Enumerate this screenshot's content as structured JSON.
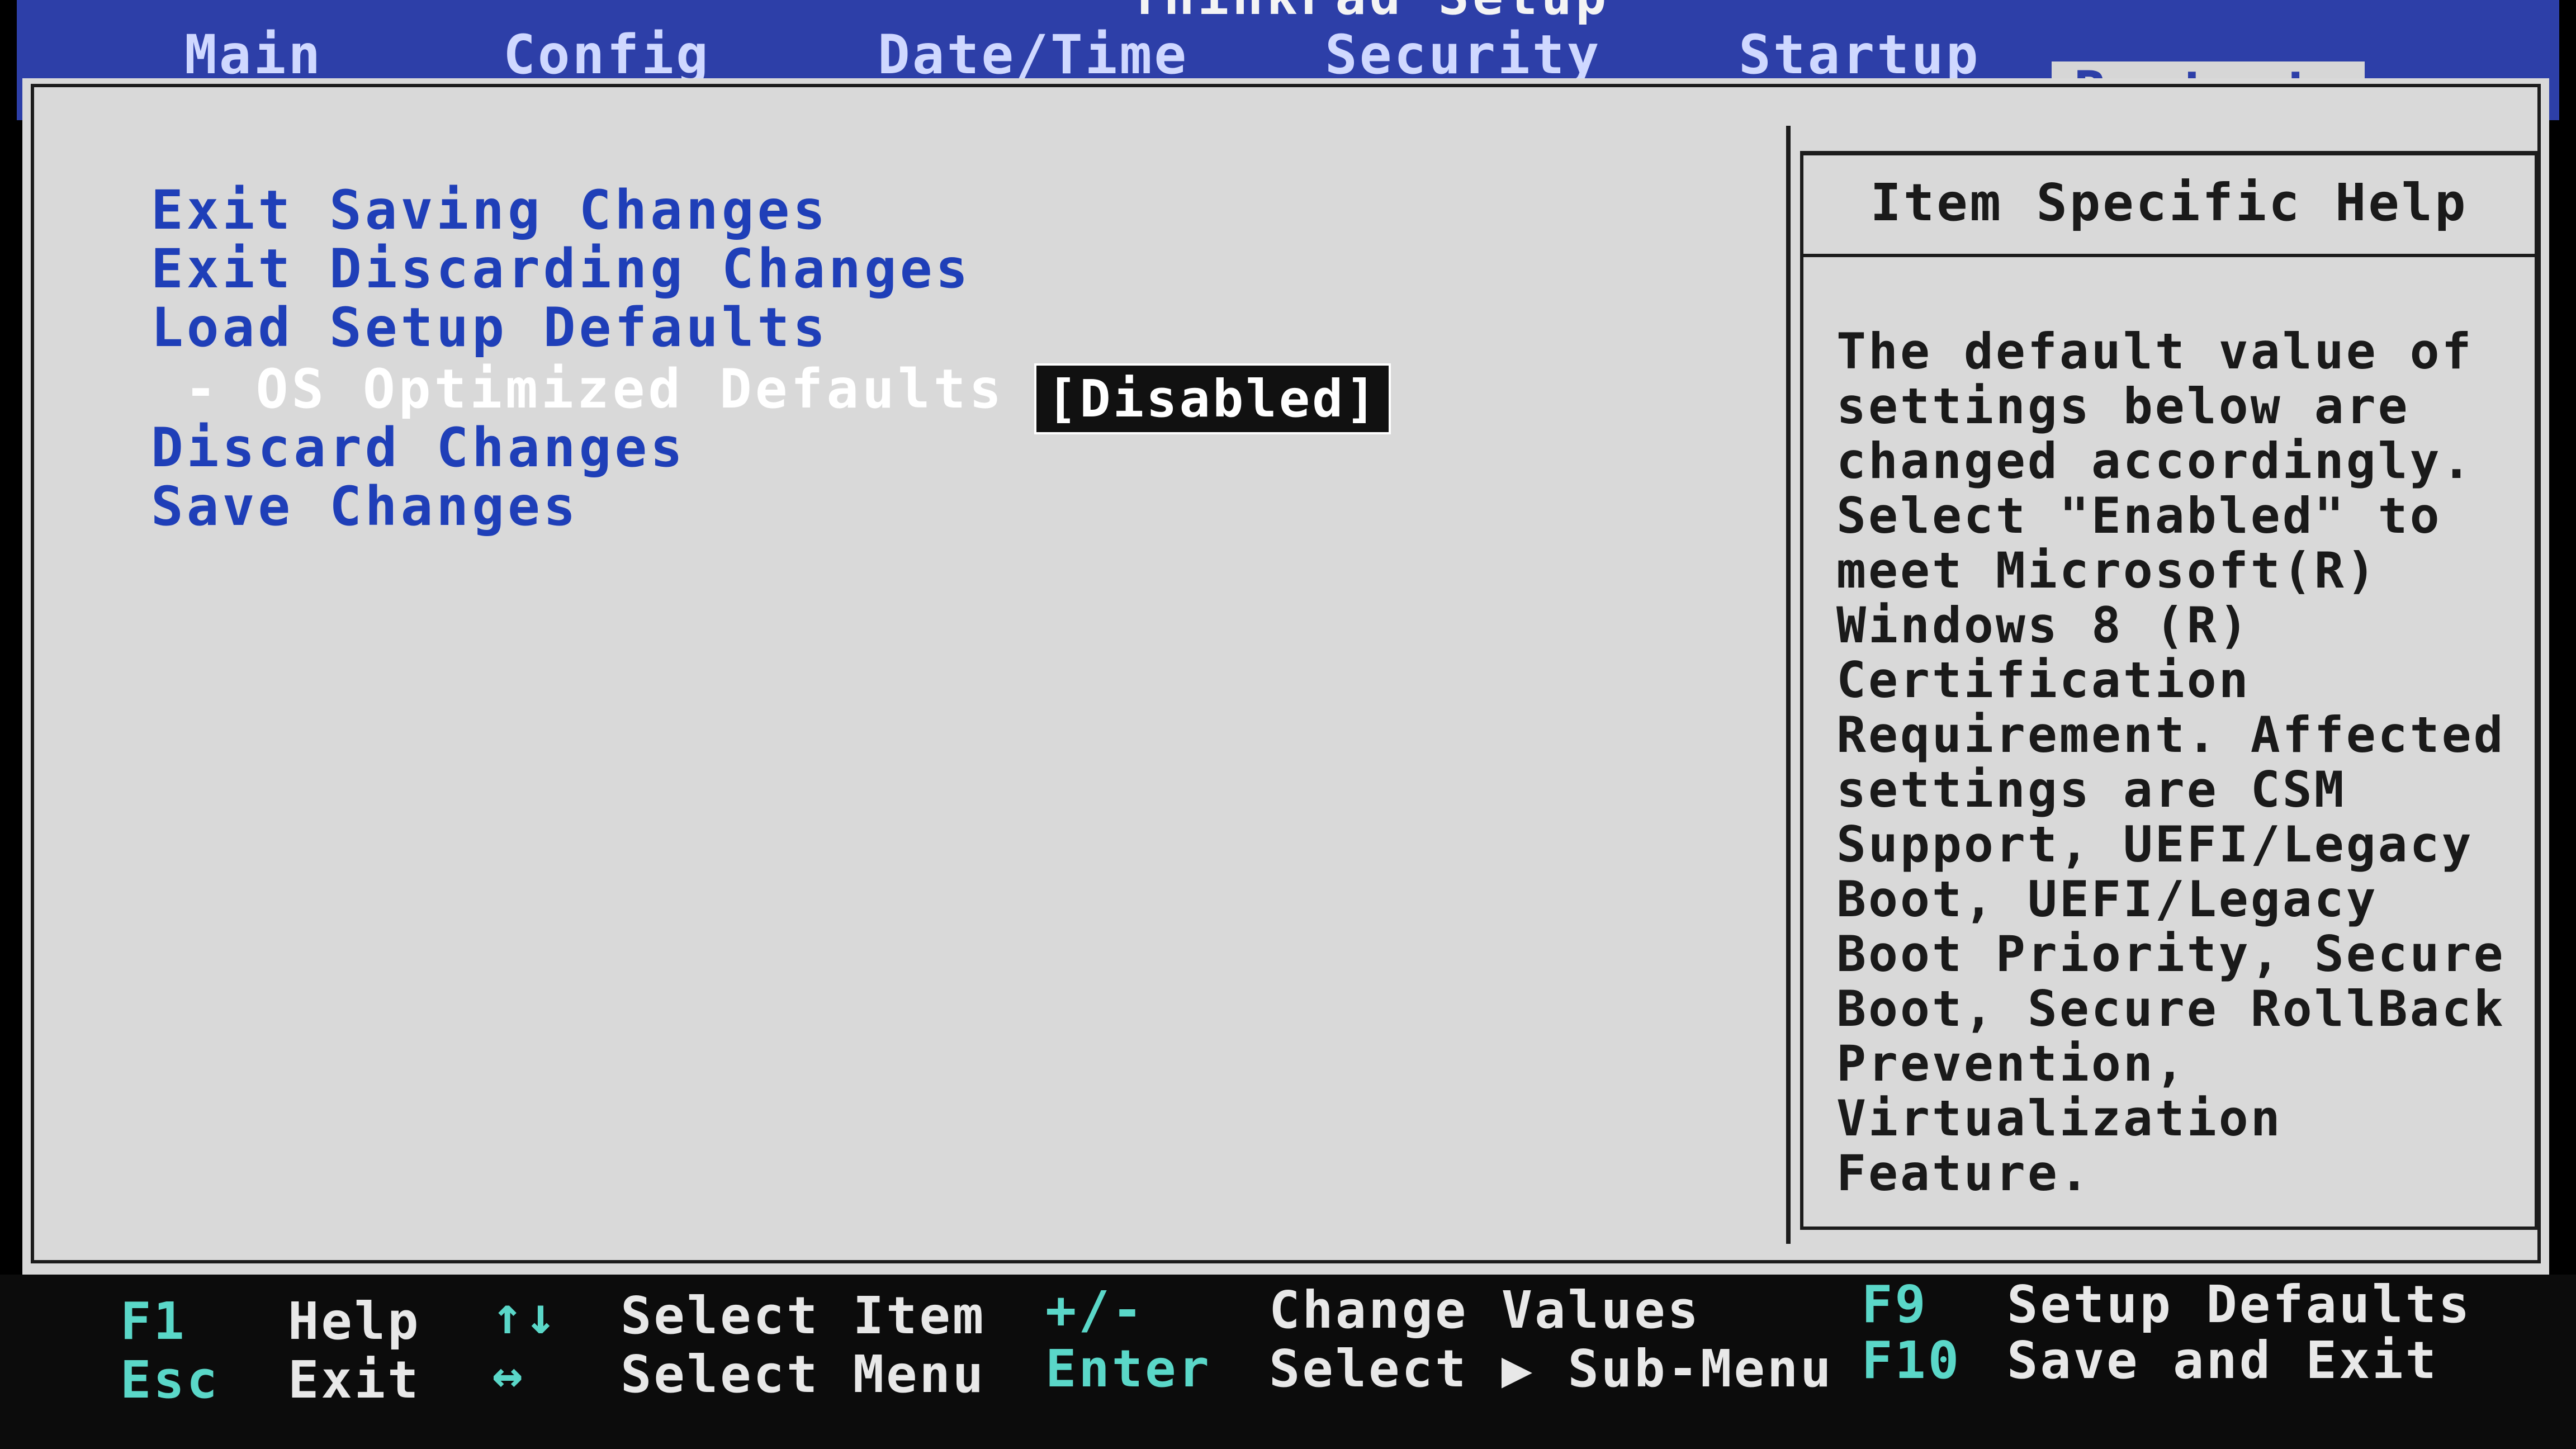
{
  "title": "ThinkPad Setup",
  "tabs": [
    "Main",
    "Config",
    "Date/Time",
    "Security",
    "Startup",
    "Restart"
  ],
  "active_tab": "Restart",
  "menu": [
    {
      "label": "Exit Saving Changes"
    },
    {
      "label": "Exit Discarding Changes"
    },
    {
      "label": "Load Setup Defaults"
    },
    {
      "label": "- OS Optimized Defaults",
      "value": "[Disabled]"
    },
    {
      "label": "Discard Changes"
    },
    {
      "label": "Save Changes"
    }
  ],
  "help": {
    "header": "Item Specific Help",
    "text": "The default value of\nsettings below are\nchanged accordingly.\nSelect \"Enabled\" to\nmeet Microsoft(R)\nWindows 8 (R)\nCertification\nRequirement. Affected\nsettings are CSM\nSupport, UEFI/Legacy\nBoot, UEFI/Legacy\nBoot Priority, Secure\nBoot, Secure RollBack\nPrevention,\nVirtualization\nFeature."
  },
  "keys": [
    {
      "key": "F1",
      "desc": "Help"
    },
    {
      "key": "Esc",
      "desc": "Exit"
    },
    {
      "key": "↑↓",
      "desc": "Select Item"
    },
    {
      "key": "↔",
      "desc": "Select Menu"
    },
    {
      "key": "+/-",
      "desc": "Change Values"
    },
    {
      "key": "Enter",
      "desc": "Select ▶ Sub-Menu"
    },
    {
      "key": "F9",
      "desc": "Setup Defaults"
    },
    {
      "key": "F10",
      "desc": "Save and Exit"
    }
  ],
  "colors": {
    "menubar": "#2d3fa8",
    "panel": "#d9d9d9",
    "menu_text": "#1f3fb8",
    "key_text": "#5ad7c8"
  }
}
